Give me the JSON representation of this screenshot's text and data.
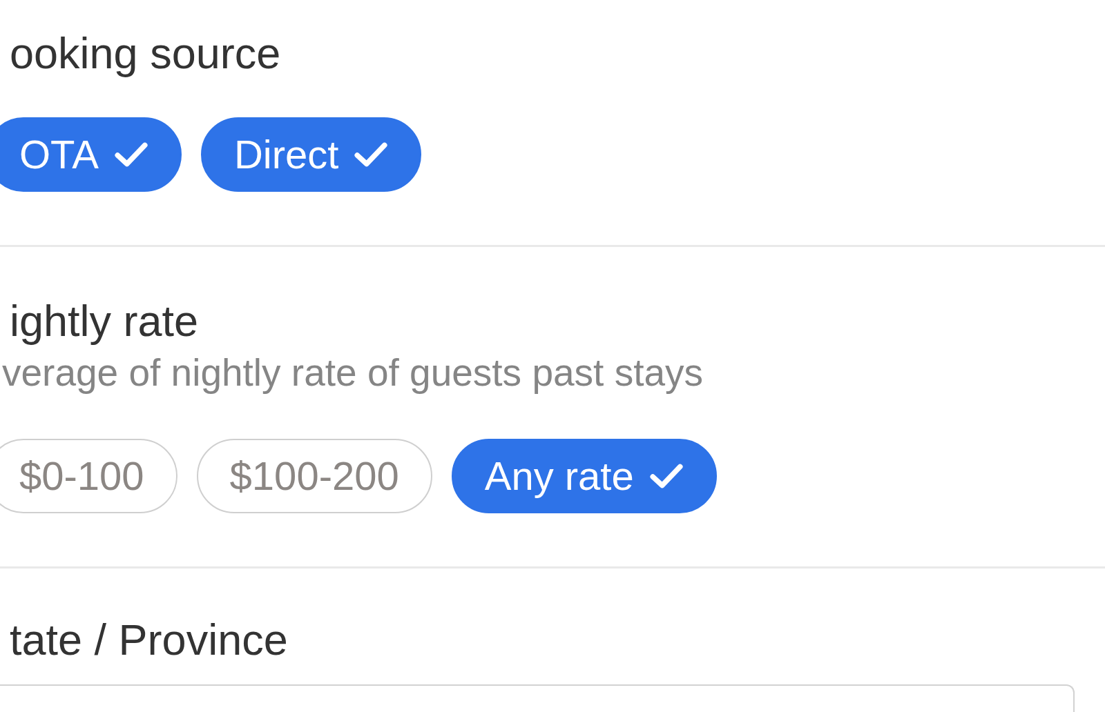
{
  "filters": [
    {
      "kind": "chips",
      "label": "ooking source",
      "options": [
        {
          "label": "OTA",
          "selected": true
        },
        {
          "label": "Direct",
          "selected": true
        }
      ]
    },
    {
      "kind": "chips",
      "label": "ightly rate",
      "description": "verage of nightly rate of guests past stays",
      "options": [
        {
          "label": "$0-100",
          "selected": false
        },
        {
          "label": "$100-200",
          "selected": false
        },
        {
          "label": "Any rate",
          "selected": true
        }
      ]
    },
    {
      "kind": "input",
      "label": "tate / Province"
    }
  ]
}
